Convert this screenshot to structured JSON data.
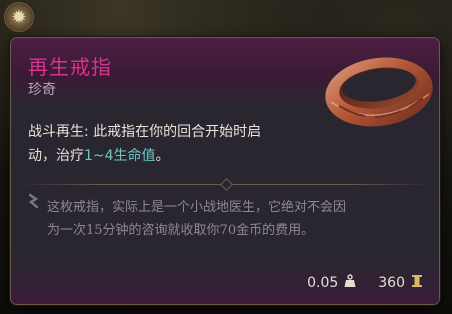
{
  "tooltip": {
    "title": "再生戒指",
    "rarity": "珍奇",
    "ability_name": "战斗再生:",
    "ability_text_1": " 此戒指在你的回合开始时启",
    "ability_text_2_prefix": "动，治疗",
    "heal_amount": "1~4生命值",
    "ability_text_2_suffix": "。",
    "flavor_line_1": "这枚戒指，实际上是一个小战地医生，它绝对不会因",
    "flavor_line_2": "为一次15分钟的咨询就收取你70金币的费用。",
    "weight": "0.05",
    "price": "360"
  },
  "icons": {
    "corner": "sun-emblem-icon",
    "item": "ring-icon",
    "flavor": "quote-icon",
    "weight": "weight-icon",
    "price": "gold-coin-icon"
  },
  "colors": {
    "title": "#d9338f",
    "heal_highlight": "#6fc7c2",
    "header_bg": "#4e1f43",
    "body_bg": "#2a2630"
  }
}
